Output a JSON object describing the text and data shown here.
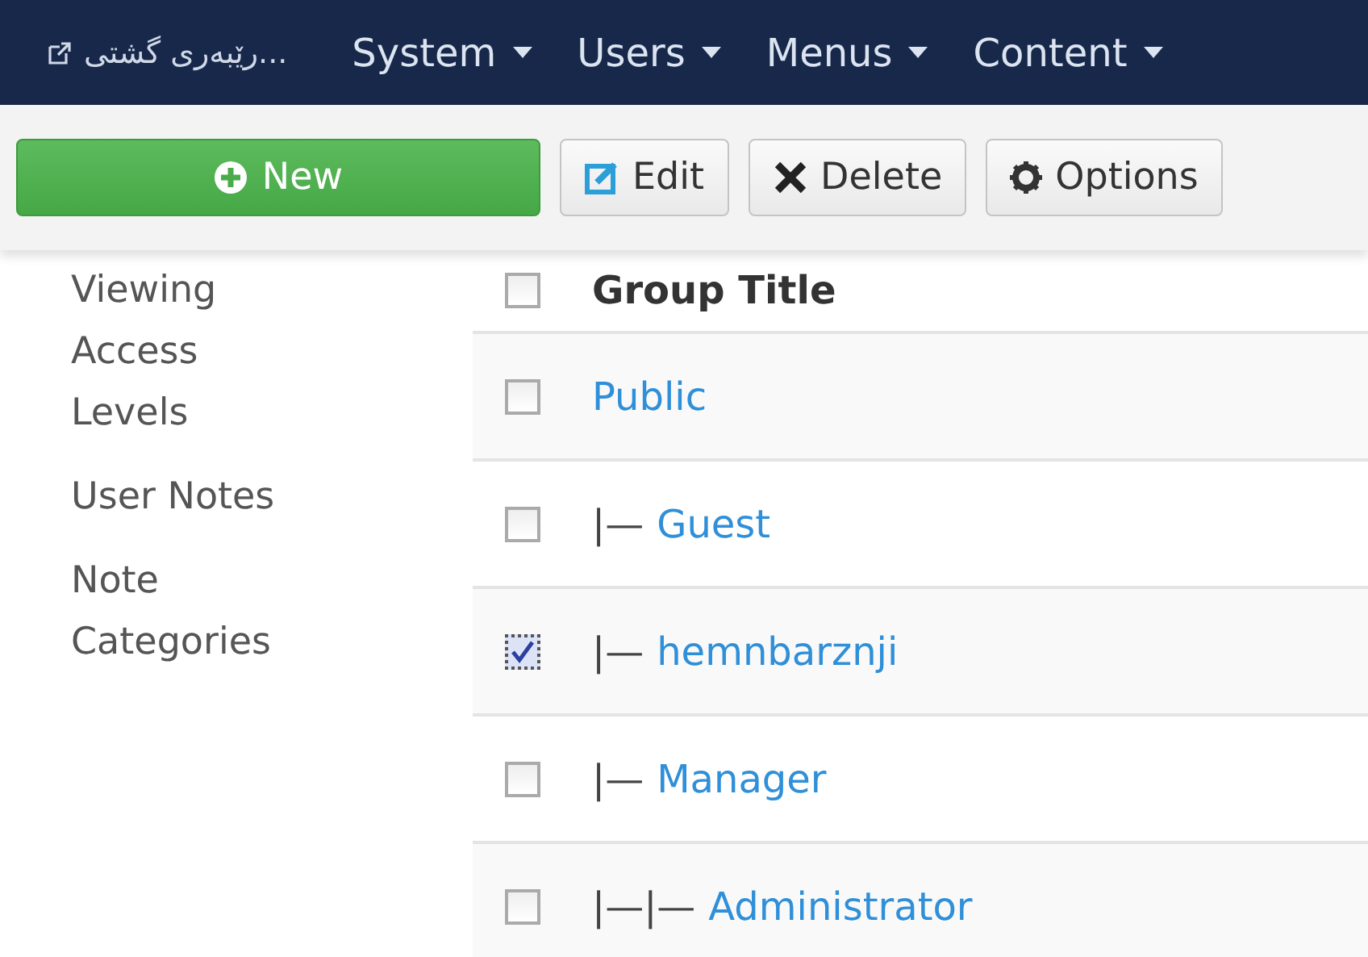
{
  "navbar": {
    "site_link": "...رێبەری گشتی",
    "menus": [
      {
        "label": "System"
      },
      {
        "label": "Users"
      },
      {
        "label": "Menus"
      },
      {
        "label": "Content"
      }
    ]
  },
  "toolbar": [
    {
      "kind": "new",
      "label": "New"
    },
    {
      "kind": "edit",
      "label": "Edit"
    },
    {
      "kind": "delete",
      "label": "Delete"
    },
    {
      "kind": "options",
      "label": "Options"
    }
  ],
  "sidebar": {
    "items": [
      {
        "label": "Viewing Access Levels"
      },
      {
        "label": "User Notes"
      },
      {
        "label": "Note Categories"
      }
    ]
  },
  "table": {
    "header": {
      "label": "Group Title",
      "checked": false
    },
    "rows": [
      {
        "title": "Public",
        "checked": false,
        "children": [
          {
            "prefix": "|—",
            "title": "Guest",
            "checked": false
          },
          {
            "prefix": "|—",
            "title": "hemnbarznji",
            "checked": true
          },
          {
            "prefix": "|—",
            "title": "Manager",
            "checked": false,
            "children": [
              {
                "prefix": "|—|—",
                "title": "Administrator",
                "checked": false
              }
            ]
          }
        ]
      }
    ]
  }
}
